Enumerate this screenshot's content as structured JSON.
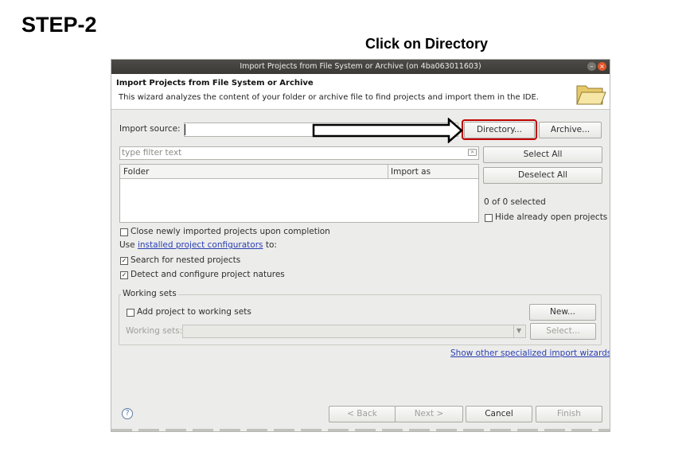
{
  "step_title": "STEP-2",
  "instruction": "Click on Directory",
  "dialog": {
    "window_title": "Import Projects from File System or Archive  (on 4ba063011603)",
    "header_title": "Import Projects from File System or Archive",
    "header_description": "This wizard analyzes the content of your folder or archive file to find projects and import them in the IDE.",
    "header_icon": "folder-icon",
    "import_source_label": "Import source:",
    "import_source_value": "",
    "directory_button": "Directory...",
    "archive_button": "Archive...",
    "filter_placeholder": "type filter text",
    "select_all_button": "Select All",
    "deselect_all_button": "Deselect All",
    "table_columns": [
      "Folder",
      "Import as"
    ],
    "selection_count": "0 of 0 selected",
    "hide_open_projects": {
      "label": "Hide already open projects",
      "checked": false
    },
    "close_imported": {
      "label": "Close newly imported projects upon completion",
      "checked": false
    },
    "use_prefix": "Use ",
    "configurators_link": "installed project configurators",
    "use_suffix": " to:",
    "search_nested": {
      "label": "Search for nested projects",
      "checked": true
    },
    "detect_natures": {
      "label": "Detect and configure project natures",
      "checked": true
    },
    "working_sets_group": "Working sets",
    "add_to_working_sets": {
      "label": "Add project to working sets",
      "checked": false
    },
    "new_button": "New...",
    "working_sets_label": "Working sets:",
    "select_button": "Select...",
    "other_wizards_link": "Show other specialized import wizards",
    "back_button": "< Back",
    "next_button": "Next >",
    "cancel_button": "Cancel",
    "finish_button": "Finish"
  },
  "colors": {
    "highlight": "#c00000",
    "link": "#2a3fb5",
    "titlebar": "#3b3a36"
  }
}
